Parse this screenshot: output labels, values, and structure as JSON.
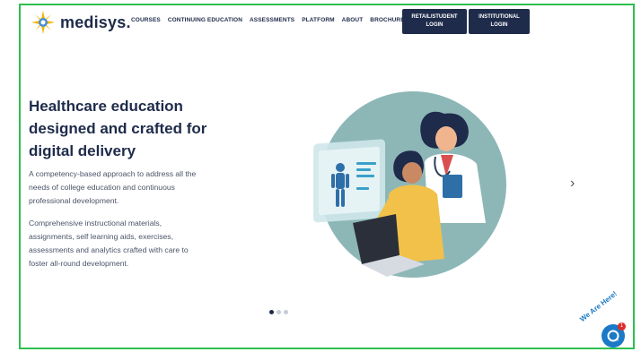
{
  "brand": {
    "name": "medisys.",
    "accent": "#1e2b4a",
    "logo_color": "#f2b705"
  },
  "nav": {
    "items": [
      "COURSES",
      "CONTINUING EDUCATION",
      "ASSESSMENTS",
      "PLATFORM",
      "ABOUT",
      "BROCHURES"
    ],
    "retail_login_line1": "RETAIL/STUDENT",
    "retail_login_line2": "LOGIN",
    "institutional_login_line1": "INSTITUTIONAL",
    "institutional_login_line2": "LOGIN"
  },
  "hero": {
    "headline_line1": "Healthcare education",
    "headline_line2": "designed and crafted for",
    "headline_line3": "digital delivery",
    "paragraph1_lines": [
      "A competency-based approach to address all the",
      "needs of college education and continuous",
      "professional development."
    ],
    "paragraph2_lines": [
      "Comprehensive instructional materials,",
      "assignments, self learning aids, exercises,",
      "assessments and analytics crafted with care to",
      "foster all-round development."
    ]
  },
  "carousel": {
    "next_symbol": "›",
    "slide_count": 3,
    "active_slide": 1
  },
  "chat": {
    "tagline": "We Are Here!",
    "badge_count": "1"
  }
}
